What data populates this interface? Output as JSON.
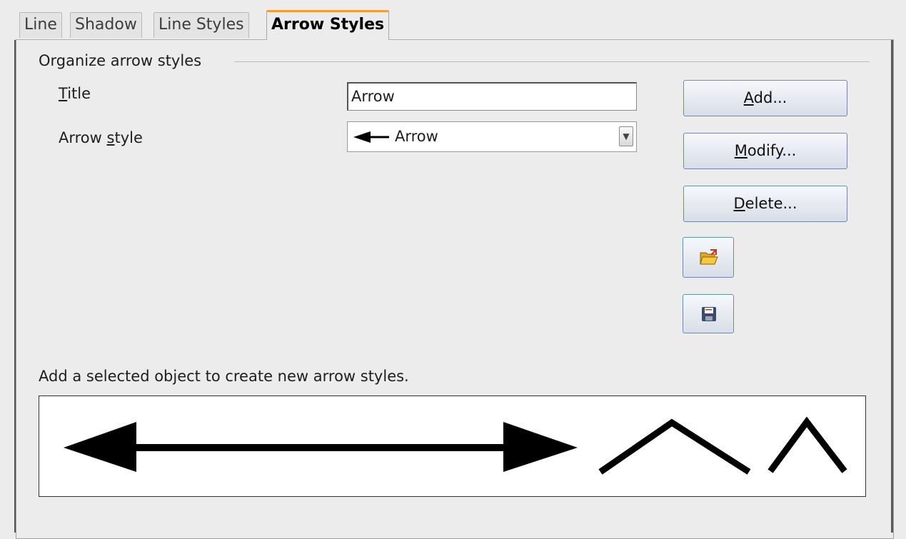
{
  "tabs": [
    {
      "label": "Line"
    },
    {
      "label": "Shadow"
    },
    {
      "label": "Line Styles"
    },
    {
      "label": "Arrow Styles",
      "active": true
    }
  ],
  "section": {
    "title": "Organize arrow styles"
  },
  "fields": {
    "title_label_mnemonic": "T",
    "title_label_rest": "itle",
    "title_value": "Arrow",
    "arrow_style_label_pre": "Arrow ",
    "arrow_style_label_mnemonic": "s",
    "arrow_style_label_rest": "tyle",
    "arrow_style_value": "Arrow"
  },
  "buttons": {
    "add": {
      "mnemonic": "A",
      "rest": "dd..."
    },
    "modify": {
      "mnemonic": "M",
      "rest": "odify..."
    },
    "delete": {
      "mnemonic": "D",
      "rest": "elete..."
    }
  },
  "icons": {
    "load": "open-folder-icon",
    "save": "floppy-disk-icon"
  },
  "hint": "Add a selected object to create new arrow styles.",
  "colors": {
    "active_tab_accent": "#f0a030",
    "button_border": "#6f8aa8"
  }
}
